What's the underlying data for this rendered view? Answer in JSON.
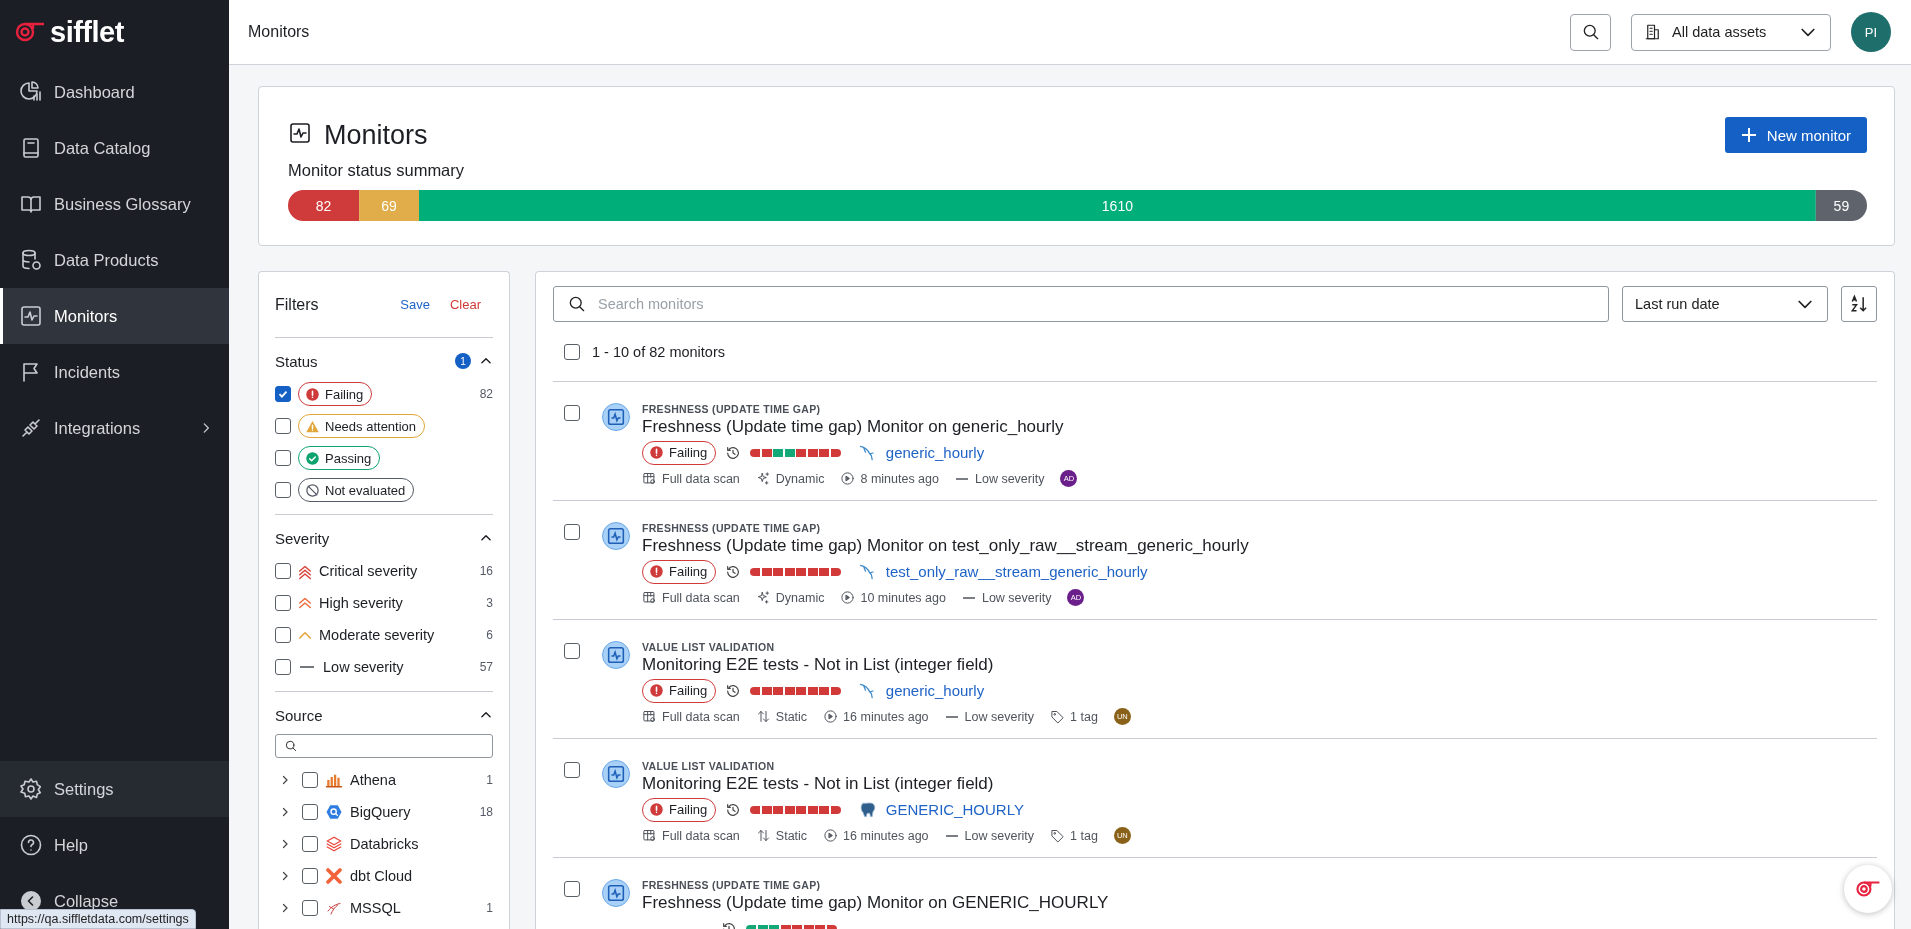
{
  "sidebar": {
    "logo": "sifflet",
    "items": [
      {
        "kind": "dashboard",
        "label": "Dashboard",
        "selected": false,
        "has_submenu": false
      },
      {
        "kind": "catalog",
        "label": "Data Catalog",
        "selected": false,
        "has_submenu": false
      },
      {
        "kind": "glossary",
        "label": "Business Glossary",
        "selected": false,
        "has_submenu": false
      },
      {
        "kind": "products",
        "label": "Data Products",
        "selected": false,
        "has_submenu": false
      },
      {
        "kind": "monitors",
        "label": "Monitors",
        "selected": true,
        "has_submenu": false
      },
      {
        "kind": "incidents",
        "label": "Incidents",
        "selected": false,
        "has_submenu": false
      },
      {
        "kind": "integrations",
        "label": "Integrations",
        "selected": false,
        "has_submenu": true
      }
    ],
    "bottom_items": [
      {
        "kind": "settings",
        "label": "Settings",
        "hovered": true
      },
      {
        "kind": "help",
        "label": "Help",
        "hovered": false
      },
      {
        "kind": "collapse",
        "label": "Collapse",
        "hovered": false
      }
    ]
  },
  "status_tooltip": "https://qa.siffletdata.com/settings",
  "topbar": {
    "title": "Monitors",
    "asset_filter": "All data assets",
    "avatar": "PI"
  },
  "header": {
    "title": "Monitors",
    "new_button": "New monitor",
    "summary_label": "Monitor status summary",
    "chart_data": {
      "type": "bar",
      "orientation": "horizontal",
      "stacked": true,
      "data_labels": true,
      "series": [
        {
          "color": "#cf3a3a",
          "values": [
            82
          ]
        },
        {
          "color": "#e0ad4a",
          "values": [
            69
          ]
        },
        {
          "color": "#00ae7a",
          "values": [
            1610
          ]
        },
        {
          "color": "#5f646c",
          "values": [
            59
          ]
        }
      ]
    }
  },
  "filters": {
    "title": "Filters",
    "save": "Save",
    "clear": "Clear",
    "status": {
      "title": "Status",
      "badge": "1",
      "expanded": true,
      "items": [
        {
          "kind": "failing",
          "label": "Failing",
          "checked": true,
          "count": "82"
        },
        {
          "kind": "needs_attention",
          "label": "Needs attention",
          "checked": false
        },
        {
          "kind": "passing",
          "label": "Passing",
          "checked": false
        },
        {
          "kind": "not_evaluated",
          "label": "Not evaluated",
          "checked": false
        }
      ]
    },
    "severity": {
      "title": "Severity",
      "expanded": true,
      "items": [
        {
          "kind": "critical",
          "label": "Critical severity",
          "checked": false,
          "count": "16"
        },
        {
          "kind": "high",
          "label": "High severity",
          "checked": false,
          "count": "3"
        },
        {
          "kind": "moderate",
          "label": "Moderate severity",
          "checked": false,
          "count": "6"
        },
        {
          "kind": "low",
          "label": "Low severity",
          "checked": false,
          "count": "57"
        }
      ]
    },
    "source": {
      "title": "Source",
      "expanded": true,
      "items": [
        {
          "kind": "athena",
          "label": "Athena",
          "checked": false,
          "count": "1"
        },
        {
          "kind": "bigquery",
          "label": "BigQuery",
          "checked": false,
          "count": "18"
        },
        {
          "kind": "databricks",
          "label": "Databricks",
          "checked": false
        },
        {
          "kind": "dbt",
          "label": "dbt Cloud",
          "checked": false
        },
        {
          "kind": "mssql",
          "label": "MSSQL",
          "checked": false,
          "count": "1"
        }
      ]
    }
  },
  "list": {
    "search_placeholder": "Search monitors",
    "sort": "Last run date",
    "select_all_checked": false,
    "count_label": "1 - 10 of 82 monitors",
    "rows": [
      {
        "checked": false,
        "type": "FRESHNESS (UPDATE TIME GAP)",
        "title": "Freshness (Update time gap) Monitor on generic_hourly",
        "status": "Failing",
        "history": [
          {
            "passed": false
          },
          {
            "passed": false
          },
          {
            "passed": true
          },
          {
            "passed": true
          },
          {
            "passed": false
          },
          {
            "passed": false
          },
          {
            "passed": false
          },
          {
            "passed": false
          }
        ],
        "dataset": {
          "kind": "mysql",
          "name": "generic_hourly"
        },
        "meta": [
          {
            "kind": "scan",
            "text": "Full data scan"
          },
          {
            "kind": "dynamic",
            "text": "Dynamic"
          },
          {
            "kind": "run",
            "text": "8 minutes ago"
          },
          {
            "kind": "severity",
            "text": "Low severity"
          }
        ],
        "avatar": {
          "initials": "AD",
          "color": "#6b1f8a"
        }
      },
      {
        "checked": false,
        "type": "FRESHNESS (UPDATE TIME GAP)",
        "title": "Freshness (Update time gap) Monitor on test_only_raw__stream_generic_hourly",
        "status": "Failing",
        "history": [
          {
            "passed": false
          },
          {
            "passed": false
          },
          {
            "passed": false
          },
          {
            "passed": false
          },
          {
            "passed": false
          },
          {
            "passed": false
          },
          {
            "passed": false
          },
          {
            "passed": false
          }
        ],
        "dataset": {
          "kind": "mysql",
          "name": "test_only_raw__stream_generic_hourly"
        },
        "meta": [
          {
            "kind": "scan",
            "text": "Full data scan"
          },
          {
            "kind": "dynamic",
            "text": "Dynamic"
          },
          {
            "kind": "run",
            "text": "10 minutes ago"
          },
          {
            "kind": "severity",
            "text": "Low severity"
          }
        ],
        "avatar": {
          "initials": "AD",
          "color": "#6b1f8a"
        }
      },
      {
        "checked": false,
        "type": "VALUE LIST VALIDATION",
        "title": "Monitoring E2E tests - Not in List (integer field)",
        "status": "Failing",
        "history": [
          {
            "passed": false
          },
          {
            "passed": false
          },
          {
            "passed": false
          },
          {
            "passed": false
          },
          {
            "passed": false
          },
          {
            "passed": false
          },
          {
            "passed": false
          },
          {
            "passed": false
          }
        ],
        "dataset": {
          "kind": "mysql",
          "name": "generic_hourly"
        },
        "meta": [
          {
            "kind": "scan",
            "text": "Full data scan"
          },
          {
            "kind": "static",
            "text": "Static"
          },
          {
            "kind": "run",
            "text": "16 minutes ago"
          },
          {
            "kind": "severity",
            "text": "Low severity"
          },
          {
            "kind": "tags",
            "text": "1 tag"
          }
        ],
        "avatar": {
          "initials": "UN",
          "color": "#8a6118"
        }
      },
      {
        "checked": false,
        "type": "VALUE LIST VALIDATION",
        "title": "Monitoring E2E tests - Not in List (integer field)",
        "status": "Failing",
        "history": [
          {
            "passed": false
          },
          {
            "passed": false
          },
          {
            "passed": false
          },
          {
            "passed": false
          },
          {
            "passed": false
          },
          {
            "passed": false
          },
          {
            "passed": false
          },
          {
            "passed": false
          }
        ],
        "dataset": {
          "kind": "postgres",
          "name": "GENERIC_HOURLY"
        },
        "meta": [
          {
            "kind": "scan",
            "text": "Full data scan"
          },
          {
            "kind": "static",
            "text": "Static"
          },
          {
            "kind": "run",
            "text": "16 minutes ago"
          },
          {
            "kind": "severity",
            "text": "Low severity"
          },
          {
            "kind": "tags",
            "text": "1 tag"
          }
        ],
        "avatar": {
          "initials": "UN",
          "color": "#8a6118"
        }
      },
      {
        "checked": false,
        "type": "FRESHNESS (UPDATE TIME GAP)",
        "title": "Freshness (Update time gap) Monitor on GENERIC_HOURLY",
        "history": [
          {
            "passed": true
          },
          {
            "passed": true
          },
          {
            "passed": true
          },
          {
            "passed": false
          },
          {
            "passed": false
          },
          {
            "passed": false
          },
          {
            "passed": false
          },
          {
            "passed": false
          }
        ],
        "meta": []
      }
    ]
  }
}
